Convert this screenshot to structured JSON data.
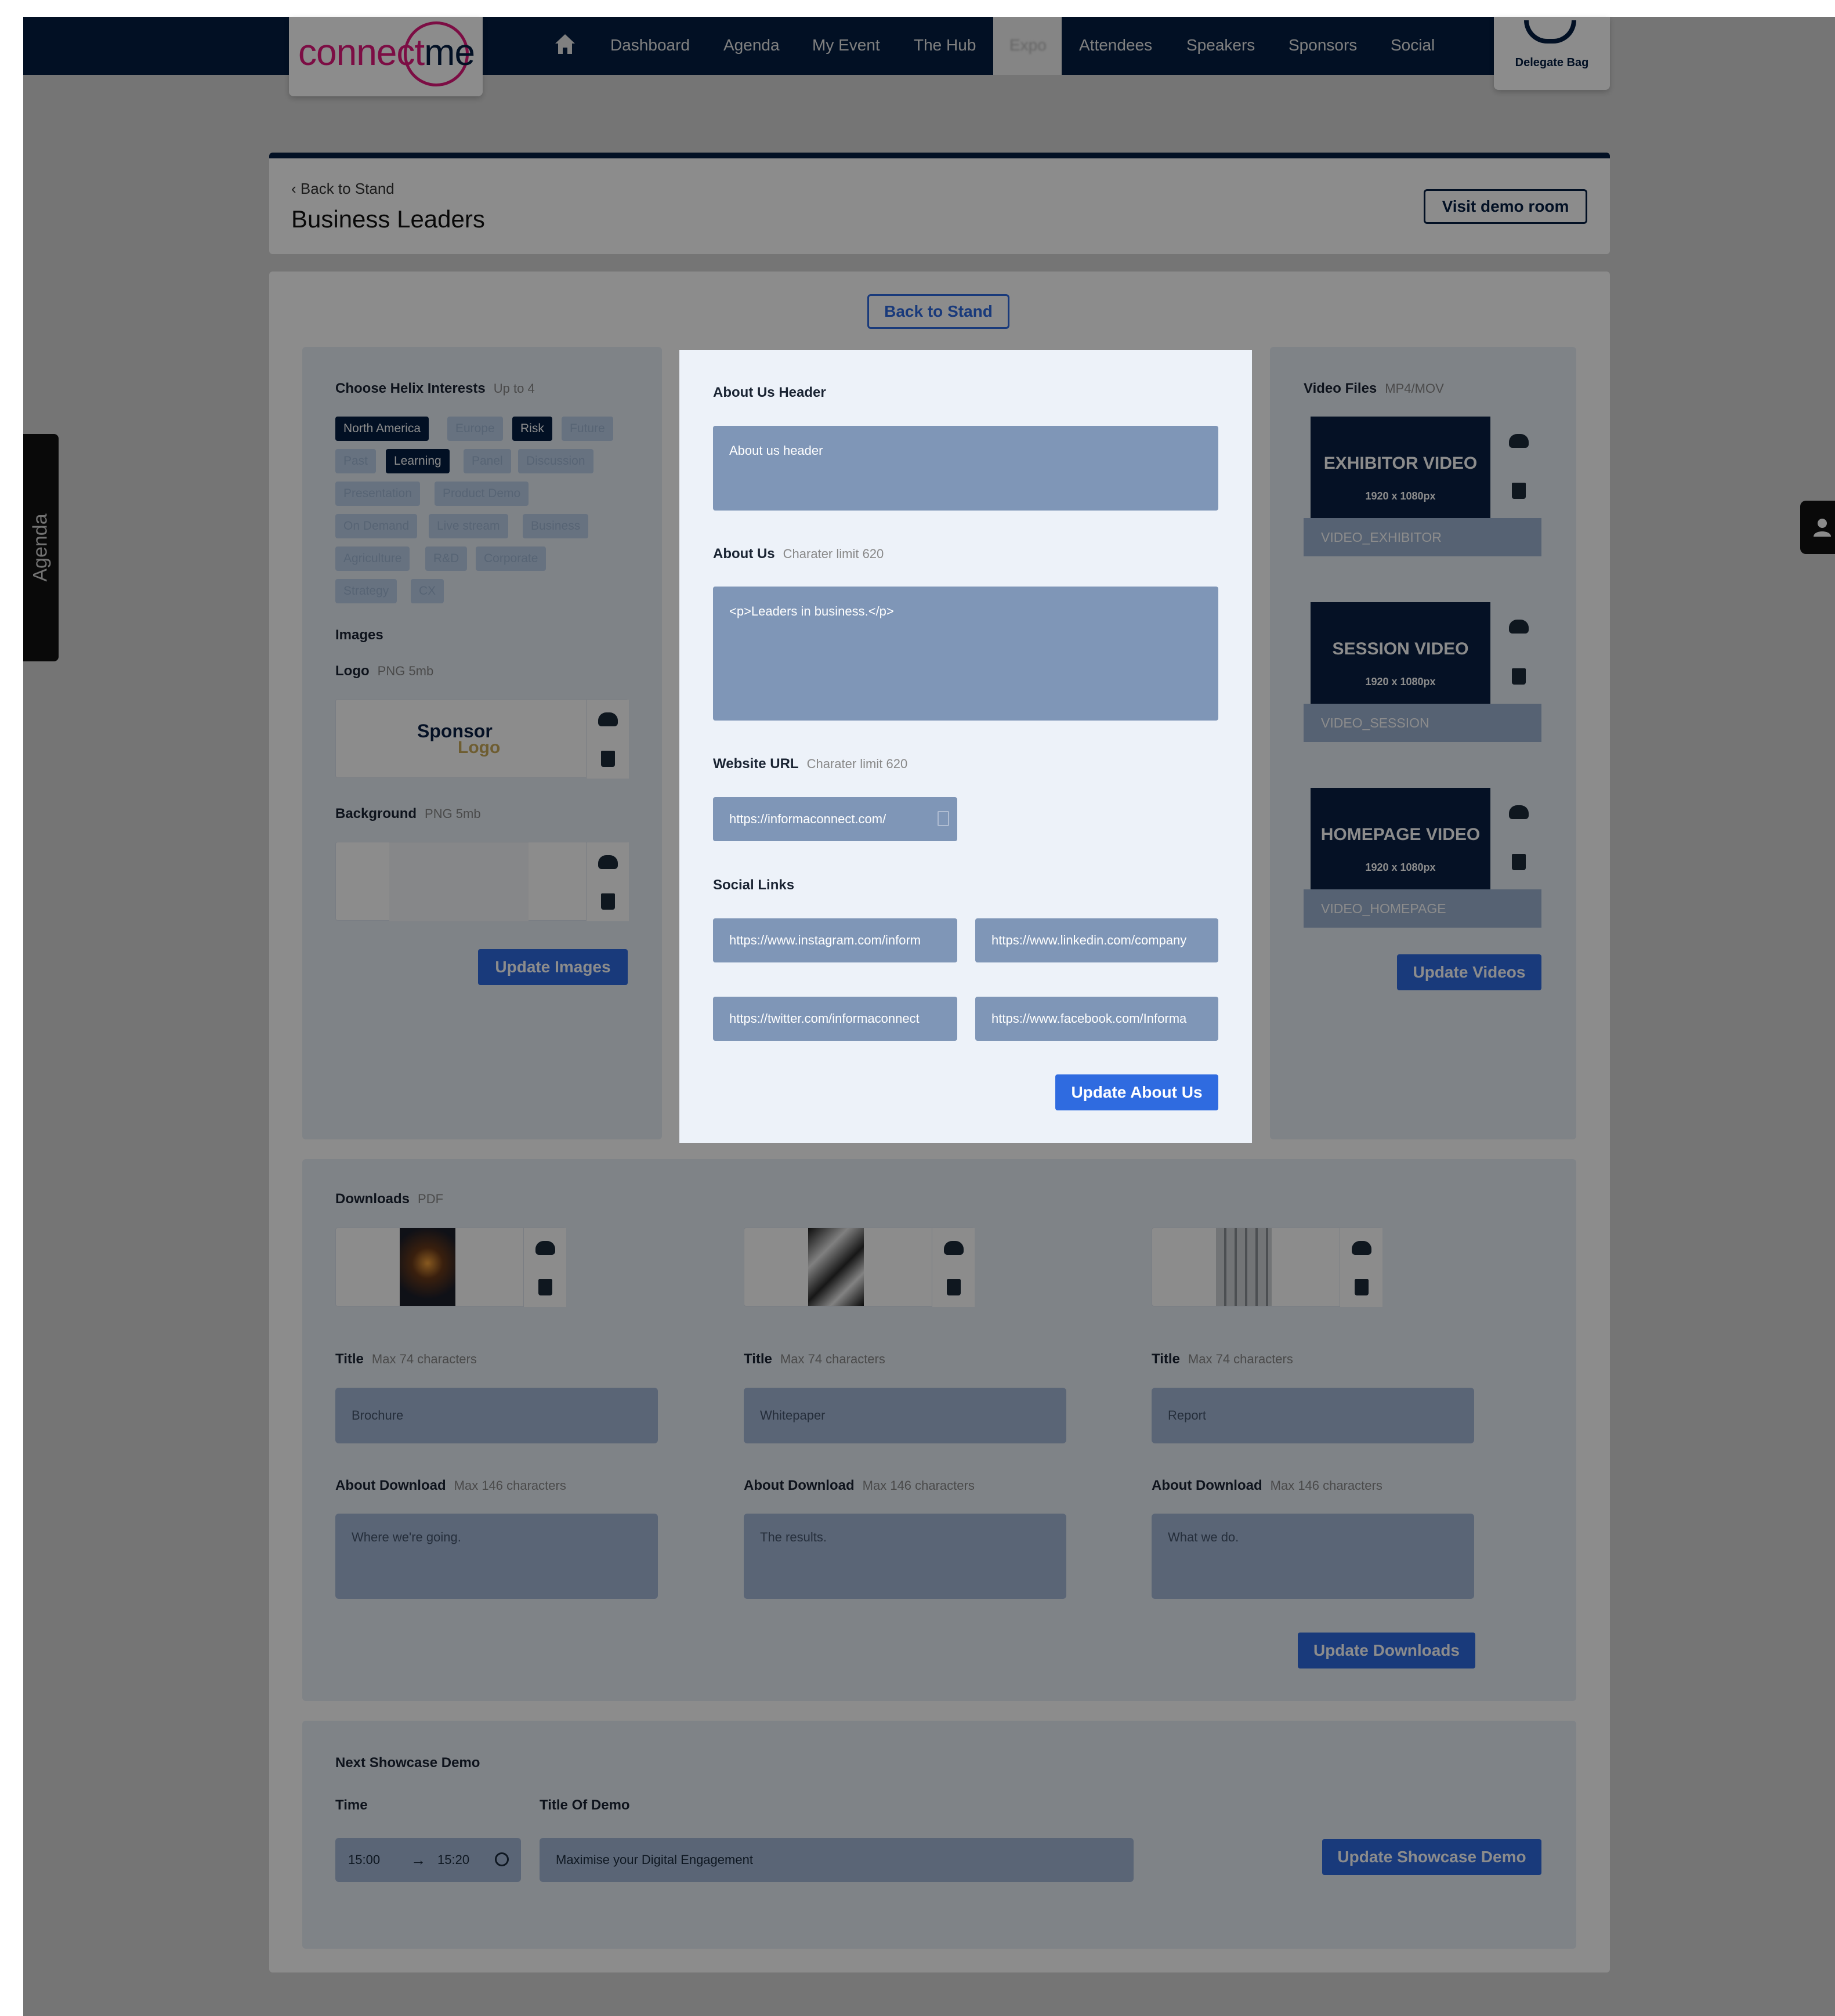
{
  "nav": {
    "logo_text": "connect",
    "logo_me": "me",
    "items": [
      "Dashboard",
      "Agenda",
      "My Event",
      "The Hub",
      "Expo",
      "Attendees",
      "Speakers",
      "Sponsors",
      "Social"
    ],
    "delegate_bag": "Delegate Bag"
  },
  "side": {
    "agenda": "Agenda"
  },
  "header": {
    "back_link": "Back to Stand",
    "title": "Business Leaders",
    "visit_demo": "Visit demo room"
  },
  "main": {
    "back_button": "Back to Stand"
  },
  "interests": {
    "label": "Choose Helix Interests",
    "hint": "Up to 4",
    "chips": [
      {
        "label": "North America",
        "selected": true
      },
      {
        "label": "Europe",
        "selected": false
      },
      {
        "label": "Risk",
        "selected": true
      },
      {
        "label": "Future",
        "selected": false
      },
      {
        "label": "Past",
        "selected": false
      },
      {
        "label": "Learning",
        "selected": true
      },
      {
        "label": "Panel",
        "selected": false
      },
      {
        "label": "Discussion",
        "selected": false
      },
      {
        "label": "Presentation",
        "selected": false
      },
      {
        "label": "Product Demo",
        "selected": false
      },
      {
        "label": "On Demand",
        "selected": false
      },
      {
        "label": "Live stream",
        "selected": false
      },
      {
        "label": "Business",
        "selected": false
      },
      {
        "label": "Agriculture",
        "selected": false
      },
      {
        "label": "R&D",
        "selected": false
      },
      {
        "label": "Corporate",
        "selected": false
      },
      {
        "label": "Strategy",
        "selected": false
      },
      {
        "label": "CX",
        "selected": false
      }
    ]
  },
  "images": {
    "heading": "Images",
    "logo_label": "Logo",
    "logo_hint": "PNG 5mb",
    "logo_text_1": "Sponsor",
    "logo_text_2": "Logo",
    "background_label": "Background",
    "background_hint": "PNG 5mb",
    "update_button": "Update Images"
  },
  "about": {
    "header_label": "About Us Header",
    "header_placeholder": "About us header",
    "about_label": "About Us",
    "about_hint": "Charater limit 620",
    "about_value": "<p>Leaders in business.</p>",
    "website_label": "Website URL",
    "website_hint": "Charater limit 620",
    "website_value": "https://informaconnect.com/",
    "social_label": "Social Links",
    "social": [
      "https://www.instagram.com/inform",
      "https://www.linkedin.com/company",
      "https://twitter.com/informaconnect",
      "https://www.facebook.com/Informa"
    ],
    "update_button": "Update About Us"
  },
  "videos": {
    "label": "Video Files",
    "hint": "MP4/MOV",
    "items": [
      {
        "title": "EXHIBITOR VIDEO",
        "size": "1920 x 1080px",
        "name": "VIDEO_EXHIBITOR"
      },
      {
        "title": "SESSION VIDEO",
        "size": "1920 x 1080px",
        "name": "VIDEO_SESSION"
      },
      {
        "title": "HOMEPAGE VIDEO",
        "size": "1920 x 1080px",
        "name": "VIDEO_HOMEPAGE"
      }
    ],
    "update_button": "Update Videos"
  },
  "downloads": {
    "label": "Downloads",
    "hint": "PDF",
    "title_label": "Title",
    "title_hint": "Max 74 characters",
    "about_label": "About Download",
    "about_hint": "Max 146 characters",
    "items": [
      {
        "title": "Brochure",
        "about": "Where we're going."
      },
      {
        "title": "Whitepaper",
        "about": "The results."
      },
      {
        "title": "Report",
        "about": "What we do."
      }
    ],
    "update_button": "Update Downloads"
  },
  "showcase": {
    "label": "Next Showcase Demo",
    "time_label": "Time",
    "title_label": "Title Of Demo",
    "start": "15:00",
    "end": "15:20",
    "title_value": "Maximise your Digital Engagement",
    "update_button": "Update Showcase Demo"
  },
  "colors": {
    "navy": "#041e42",
    "brand_pink": "#e2187d",
    "primary_button": "#2f6be0",
    "input_fill": "#7f96b7"
  }
}
